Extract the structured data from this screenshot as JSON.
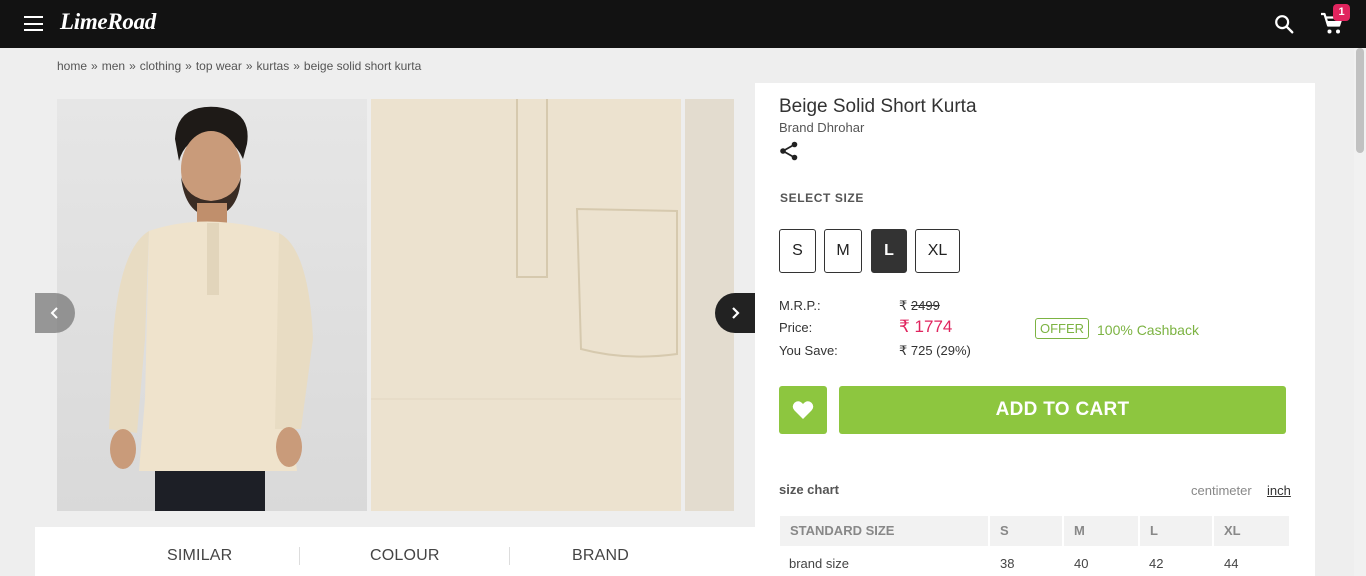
{
  "header": {
    "logo": "LimeRoad",
    "cart_count": "1"
  },
  "breadcrumb": [
    "home",
    "men",
    "clothing",
    "top wear",
    "kurtas",
    "beige solid short kurta"
  ],
  "breadcrumb_sep": "»",
  "product": {
    "title": "Beige Solid Short Kurta",
    "brand": "Brand Dhrohar"
  },
  "sizes": {
    "label": "SELECT SIZE",
    "options": [
      "S",
      "M",
      "L",
      "XL"
    ],
    "selected": "L"
  },
  "pricing": {
    "mrp_label": "M.R.P.:",
    "mrp_currency": "₹",
    "mrp_value": "2499",
    "price_label": "Price:",
    "price_value": "₹ 1774",
    "save_label": "You Save:",
    "save_value": "₹ 725 (29%)",
    "offer_badge": "OFFER",
    "offer_text": "100% Cashback"
  },
  "actions": {
    "add_to_cart": "ADD TO CART"
  },
  "size_chart": {
    "title": "size chart",
    "unit_cm": "centimeter",
    "unit_inch": "inch",
    "selected_unit": "inch",
    "headers": [
      "STANDARD SIZE",
      "S",
      "M",
      "L",
      "XL"
    ],
    "rows": [
      [
        "brand size",
        "38",
        "40",
        "42",
        "44"
      ]
    ]
  },
  "tabs": [
    "SIMILAR",
    "COLOUR",
    "BRAND"
  ],
  "colors": {
    "accent_green": "#8dc63f",
    "price_pink": "#e0245e",
    "offer_green": "#7cb342",
    "header_bg": "#121212"
  }
}
